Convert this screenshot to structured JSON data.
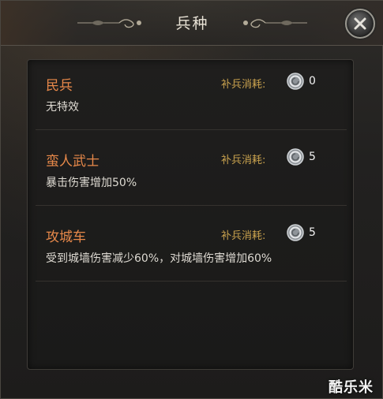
{
  "window": {
    "title": "兵种",
    "close_icon": "close-x-icon"
  },
  "units": [
    {
      "name": "民兵",
      "effect": "无特效",
      "cost_label": "补兵消耗:",
      "cost_icon": "silver-coin-icon",
      "cost_value": "0"
    },
    {
      "name": "蛮人武士",
      "effect": "暴击伤害增加50%",
      "cost_label": "补兵消耗:",
      "cost_icon": "silver-coin-icon",
      "cost_value": "5"
    },
    {
      "name": "攻城车",
      "effect": "受到城墙伤害减少60%，对城墙伤害增加60%",
      "cost_label": "补兵消耗:",
      "cost_icon": "silver-coin-icon",
      "cost_value": "5"
    }
  ],
  "watermark": "酷乐米",
  "colors": {
    "unit_name": "#e8894a",
    "cost_label": "#c9a24e",
    "effect_text": "#dedad2"
  }
}
